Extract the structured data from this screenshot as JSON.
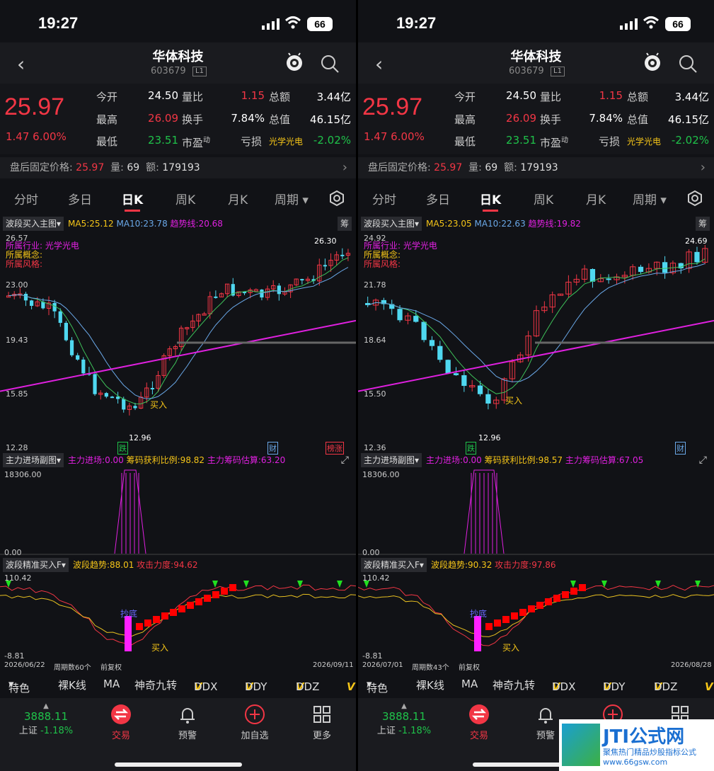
{
  "status": {
    "time": "19:27",
    "battery": "66"
  },
  "stock": {
    "name": "华体科技",
    "code": "603679",
    "level": "L1"
  },
  "quote": {
    "price": "25.97",
    "change": "1.47 6.00%",
    "labels": {
      "open": "今开",
      "high": "最高",
      "low": "最低",
      "vol_ratio": "量比",
      "turnover": "换手",
      "pe": "市盈",
      "pe_sup": "动",
      "amount": "总额",
      "mktcap": "总值",
      "loss": "亏损"
    },
    "open": "24.50",
    "high": "26.09",
    "low": "23.51",
    "vol_ratio": "1.15",
    "turnover": "7.84%",
    "amount": "3.44亿",
    "mktcap": "46.15亿",
    "sector": "光学光电",
    "sector_chg": "-2.02%"
  },
  "after_hours": {
    "label": "盘后固定价格:",
    "price": "25.97",
    "vol_label": "量:",
    "vol": "69",
    "amt_label": "额:",
    "amt": "179193"
  },
  "tabs": [
    "分时",
    "多日",
    "日K",
    "周K",
    "月K",
    "周期"
  ],
  "indicator_bar": {
    "items": [
      "特色",
      "裸K线",
      "MA",
      "神奇九转",
      "DDX",
      "DDY",
      "DDZ"
    ],
    "v": "V"
  },
  "bottom_nav": {
    "index_value": "3888.11",
    "index_label": "上证",
    "index_chg": "-1.18%",
    "items": [
      "交易",
      "预警",
      "加自选",
      "更多"
    ]
  },
  "panels": [
    {
      "main_sel": "波段买入主图",
      "ma5": "MA5:25.12",
      "ma10": "MA10:23.78",
      "trend": "趋势线:20.68",
      "badge": "筹",
      "industry": "所属行业:",
      "industry_val": "光学光电",
      "concept": "所属概念:",
      "style": "所属风格:",
      "axis": [
        "26.57",
        "23.00",
        "19.43",
        "15.85",
        "12.28"
      ],
      "hi_label": "26.30",
      "lo_label": "12.96",
      "tags": [
        "跌",
        "财",
        "榜涨"
      ],
      "buy": "买入",
      "sub1_sel": "主力进场副图",
      "sub1_a": "主力进场:0.00",
      "sub1_b": "筹码获利比例:98.82",
      "sub1_c": "主力筹码估算:63.20",
      "sub1_axis": [
        "18306.00",
        "0.00"
      ],
      "sub2_sel": "波段精准买入F",
      "sub2_a": "波段趋势:88.01",
      "sub2_b": "攻击力度:94.62",
      "sub2_axis": [
        "110.42",
        "-8.81"
      ],
      "sub2_tag": "抄底",
      "date_start": "2026/06/22",
      "date_end": "2026/09/11",
      "period": "周期数60个",
      "adj": "前复权"
    },
    {
      "main_sel": "波段买入主图",
      "ma5": "MA5:23.05",
      "ma10": "MA10:22.63",
      "trend": "趋势线:19.82",
      "badge": "筹",
      "industry": "所属行业:",
      "industry_val": "光学光电",
      "concept": "所属概念:",
      "style": "所属风格:",
      "axis": [
        "24.92",
        "21.78",
        "18.64",
        "15.50",
        "12.36"
      ],
      "hi_label": "24.69",
      "lo_label": "12.96",
      "tags": [
        "跌",
        "财"
      ],
      "buy": "买入",
      "sub1_sel": "主力进场副图",
      "sub1_a": "主力进场:0.00",
      "sub1_b": "筹码获利比例:98.57",
      "sub1_c": "主力筹码估算:67.05",
      "sub1_axis": [
        "18306.00",
        "0.00"
      ],
      "sub2_sel": "波段精准买入F",
      "sub2_a": "波段趋势:90.32",
      "sub2_b": "攻击力度:97.86",
      "sub2_axis": [
        "110.42",
        "-8.81"
      ],
      "sub2_tag": "抄底",
      "date_start": "2026/07/01",
      "date_end": "2026/08/28",
      "period": "周期数43个",
      "adj": "前复权"
    }
  ],
  "watermark": {
    "name": "JTI公式网",
    "slogan": "聚焦热门精品炒股指标公式",
    "url": "www.66gsw.com"
  },
  "colors": {
    "up": "#f23645",
    "down": "#1fc24a",
    "ma10": "#6aa8e8",
    "trend": "#e020e0",
    "accent": "#f5c518"
  }
}
